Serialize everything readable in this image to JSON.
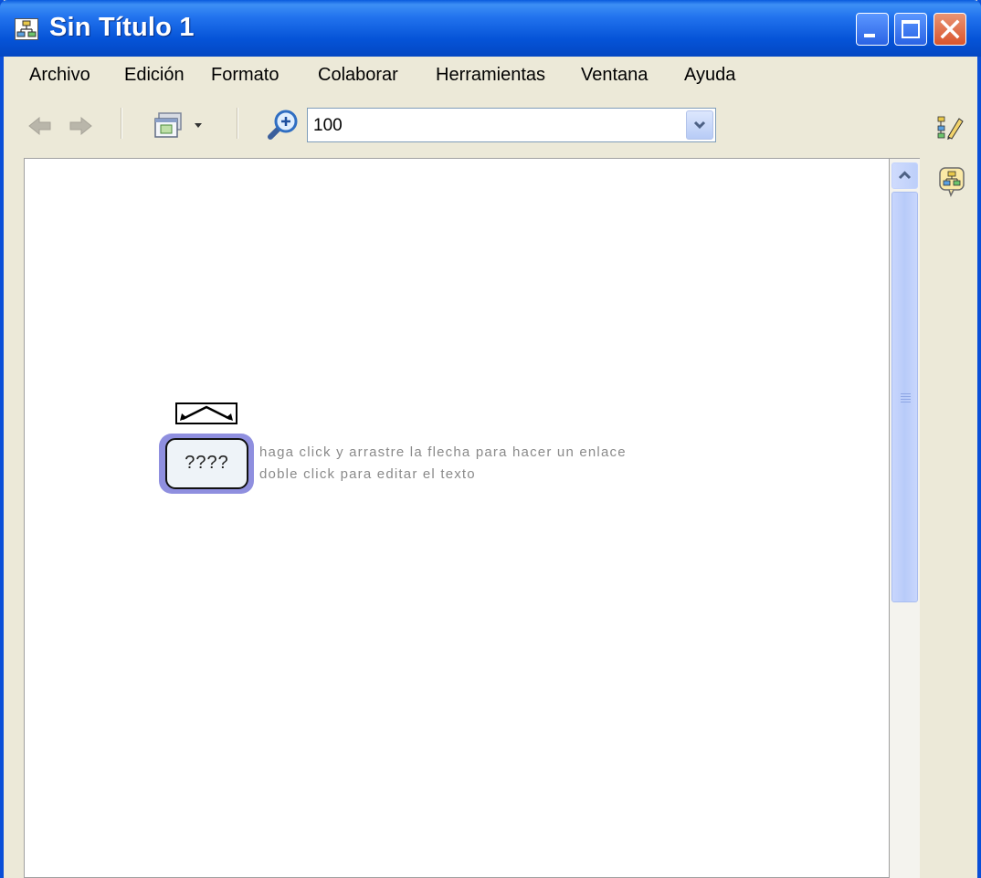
{
  "window": {
    "title": "Sin Título 1",
    "buttons": {
      "minimize": "minimize-icon",
      "maximize": "maximize-icon",
      "close": "close-icon"
    }
  },
  "menu": {
    "items": [
      "Archivo",
      "Edición",
      "Formato",
      "Colaborar",
      "Herramientas",
      "Ventana",
      "Ayuda"
    ]
  },
  "toolbar": {
    "back_icon": "arrow-left-icon",
    "forward_icon": "arrow-right-icon",
    "view_icon": "view-menu-icon",
    "zoom_icon": "zoom-in-icon",
    "zoom_value": "100"
  },
  "side_tools": [
    "style-palette-icon",
    "collaboration-icon"
  ],
  "canvas": {
    "node_label": "????",
    "hint_line1": "haga click y arrastre la flecha para hacer un enlace",
    "hint_line2": "doble click para editar el texto"
  },
  "colors": {
    "title_bar": "#0553d7",
    "node_glow": "#8f8fdf",
    "node_fill": "#eef3f8",
    "hint_text": "#8a8a8a"
  }
}
